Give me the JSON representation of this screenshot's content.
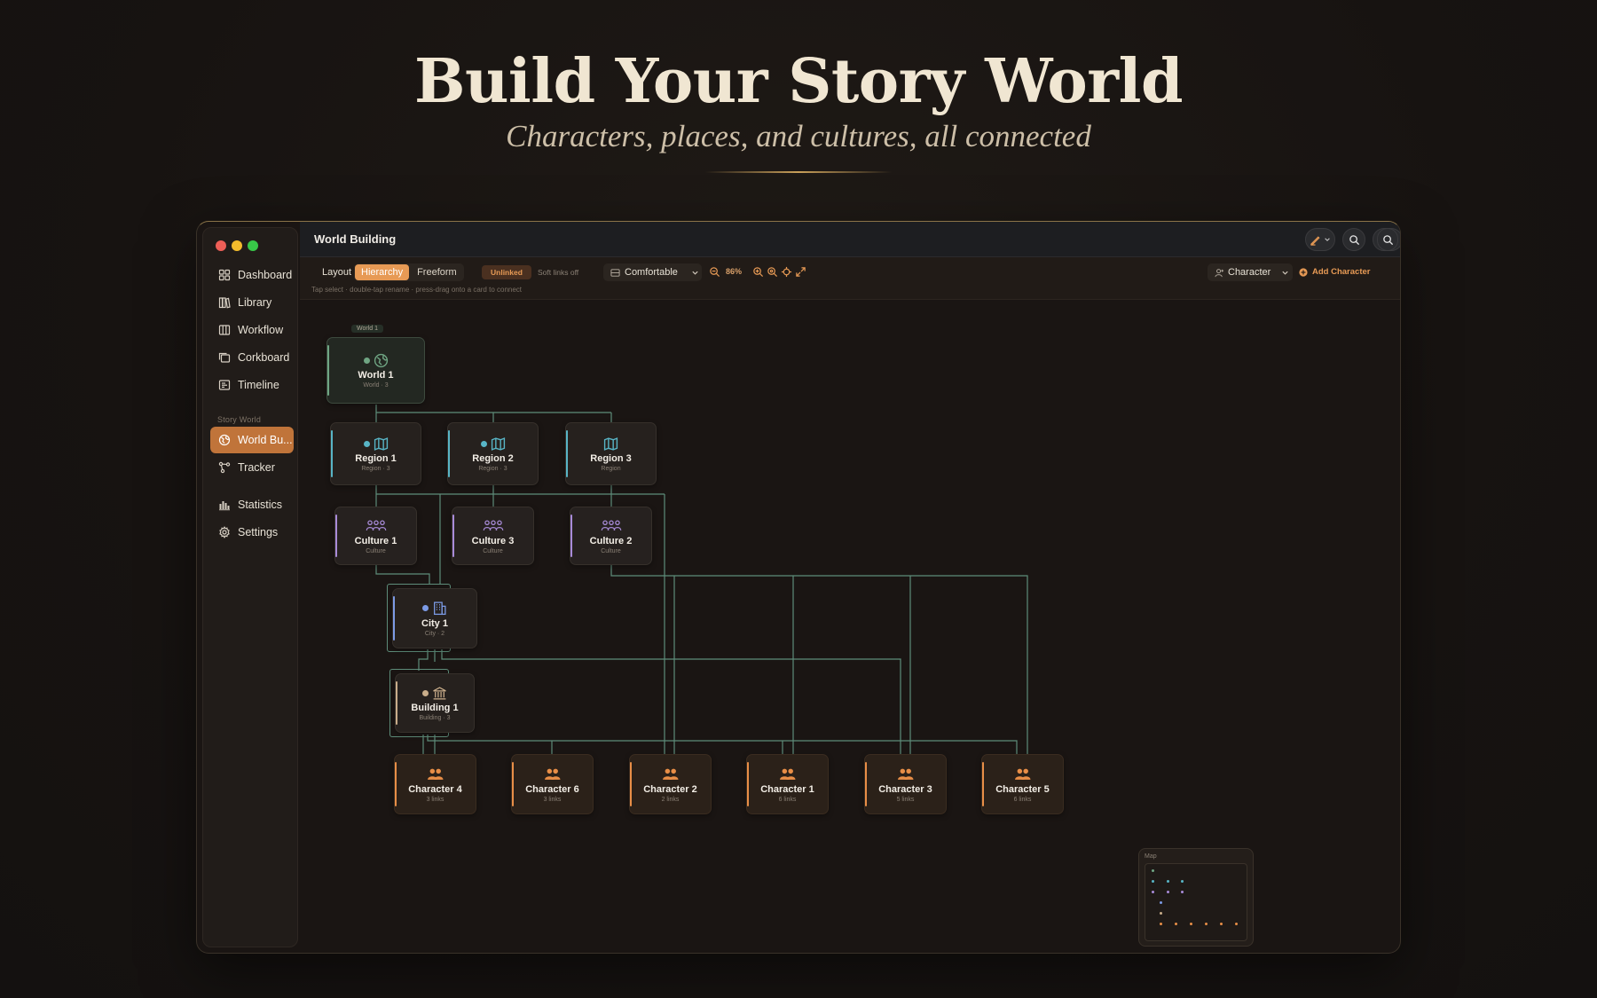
{
  "hero": {
    "title": "Build Your Story World",
    "subtitle": "Characters, places, and cultures, all connected"
  },
  "window": {
    "title": "World Building"
  },
  "sidebar": {
    "items": [
      {
        "label": "Dashboard",
        "icon": "grid-icon"
      },
      {
        "label": "Library",
        "icon": "books-icon"
      },
      {
        "label": "Workflow",
        "icon": "columns-icon"
      },
      {
        "label": "Corkboard",
        "icon": "cards-icon"
      },
      {
        "label": "Timeline",
        "icon": "timeline-icon"
      }
    ],
    "section_label": "Story World",
    "story_items": [
      {
        "label": "World Bu...",
        "icon": "globe-icon",
        "active": true
      },
      {
        "label": "Tracker",
        "icon": "nodes-icon"
      }
    ],
    "bottom_items": [
      {
        "label": "Statistics",
        "icon": "bar-chart-icon"
      },
      {
        "label": "Settings",
        "icon": "gear-icon"
      }
    ]
  },
  "toolbar": {
    "layout_label": "Layout",
    "layout_options": [
      "Hierarchy",
      "Freeform"
    ],
    "layout_selected": "Hierarchy",
    "unlinked_label": "Unlinked",
    "soft_links_label": "Soft links off",
    "density_value": "Comfortable",
    "zoom_value": "86%",
    "hint": "Tap select · double-tap rename · press-drag onto a card to connect",
    "type_select_value": "Character",
    "add_label": "Add Character"
  },
  "colors": {
    "accent_orange": "#e79a55",
    "world_green": "#6fa583",
    "region_teal": "#58b5c6",
    "culture_purple": "#a88bd8",
    "city_blue": "#7c9be6",
    "building_tan": "#c9ad8a",
    "character_orange": "#e88e47",
    "link_green": "#5e8d7a"
  },
  "nodes": {
    "world_tag": "World 1",
    "world": {
      "label": "World 1",
      "sub": "World · 3"
    },
    "regions": [
      {
        "label": "Region 1",
        "sub": "Region · 3",
        "badge": true
      },
      {
        "label": "Region 2",
        "sub": "Region · 3",
        "badge": true
      },
      {
        "label": "Region 3",
        "sub": "Region",
        "badge": false
      }
    ],
    "cultures": [
      {
        "label": "Culture 1",
        "sub": "Culture"
      },
      {
        "label": "Culture 3",
        "sub": "Culture"
      },
      {
        "label": "Culture 2",
        "sub": "Culture"
      }
    ],
    "city": {
      "label": "City 1",
      "sub": "City · 2"
    },
    "building": {
      "label": "Building 1",
      "sub": "Building · 3"
    },
    "characters": [
      {
        "label": "Character 4",
        "sub": "3 links"
      },
      {
        "label": "Character 6",
        "sub": "3 links"
      },
      {
        "label": "Character 2",
        "sub": "2 links"
      },
      {
        "label": "Character 1",
        "sub": "6 links"
      },
      {
        "label": "Character 3",
        "sub": "5 links"
      },
      {
        "label": "Character 5",
        "sub": "6 links"
      }
    ]
  },
  "minimap": {
    "title": "Map"
  }
}
